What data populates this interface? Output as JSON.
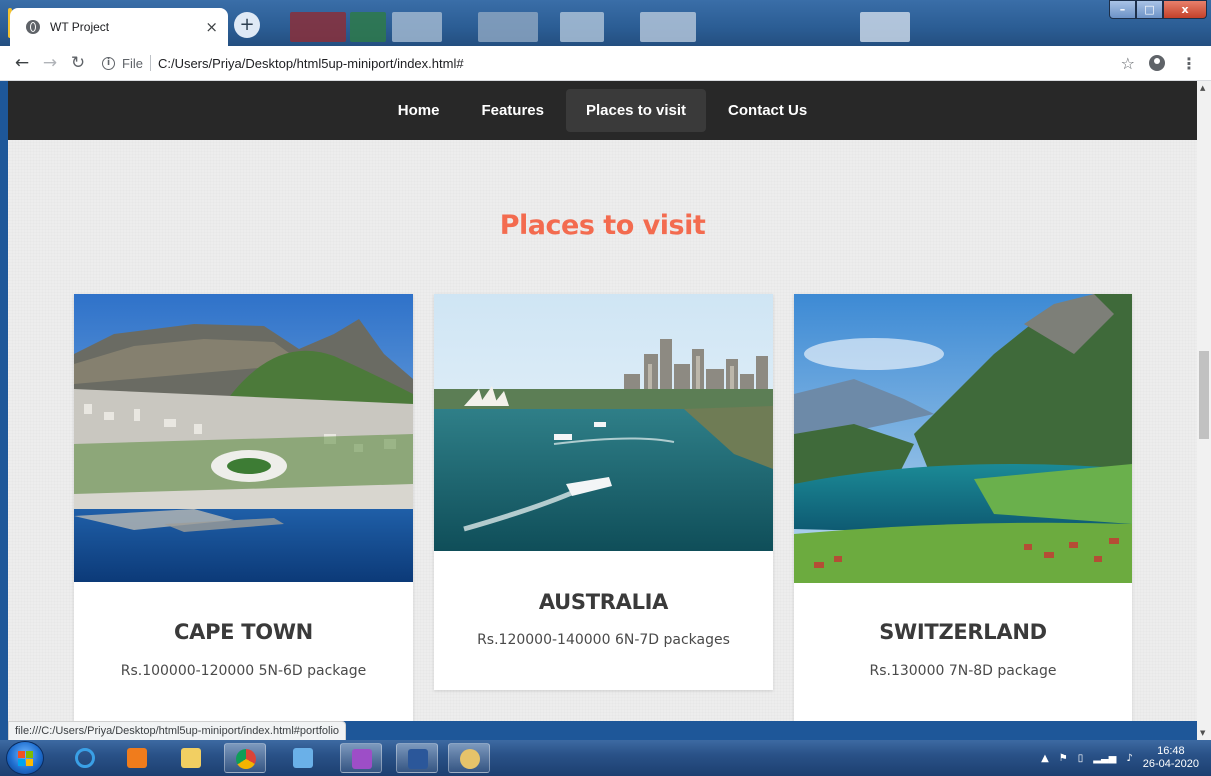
{
  "browser": {
    "tab_title": "WT Project",
    "tab_close": "×",
    "new_tab": "+",
    "url_scheme": "File",
    "url": "C:/Users/Priya/Desktop/html5up-miniport/index.html#",
    "status_url": "file:///C:/Users/Priya/Desktop/html5up-miniport/index.html#portfolio",
    "window_buttons": [
      "–",
      "□",
      "x"
    ]
  },
  "nav": {
    "items": [
      {
        "label": "Home",
        "active": false
      },
      {
        "label": "Features",
        "active": false
      },
      {
        "label": "Places to visit",
        "active": true
      },
      {
        "label": "Contact Us",
        "active": false
      }
    ]
  },
  "section": {
    "heading": "Places to visit",
    "heading_color": "#f36b4f"
  },
  "cards": [
    {
      "title": "CAPE TOWN",
      "description": "Rs.100000-120000 5N-6D package",
      "image": "cape-town-photo"
    },
    {
      "title": "AUSTRALIA",
      "description": "Rs.120000-140000 6N-7D packages",
      "image": "sydney-harbour-photo"
    },
    {
      "title": "SWITZERLAND",
      "description": "Rs.130000 7N-8D package",
      "image": "swiss-lake-photo"
    }
  ],
  "taskbar": {
    "clock_time": "16:48",
    "clock_date": "26-04-2020"
  }
}
